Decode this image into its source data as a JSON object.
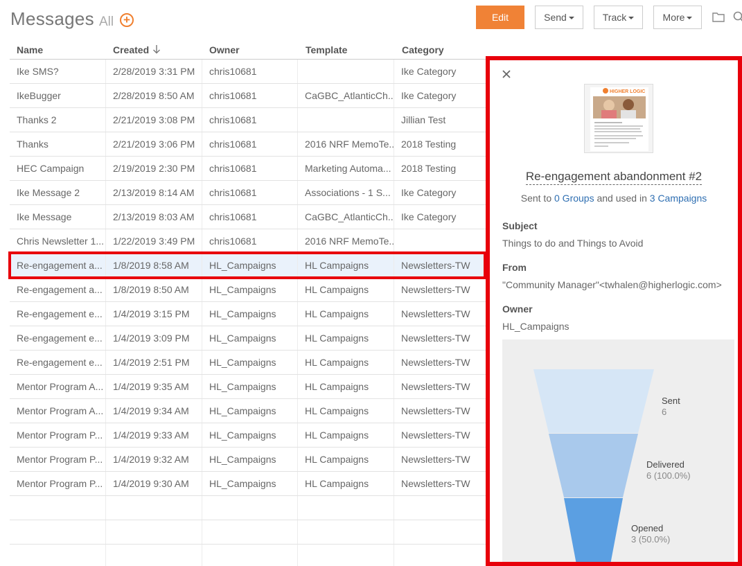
{
  "header": {
    "title": "Messages",
    "subtitle": "All",
    "add_label": "+"
  },
  "toolbar": {
    "edit_label": "Edit",
    "send_label": "Send",
    "track_label": "Track",
    "more_label": "More",
    "folder_icon": "folder-icon",
    "search_icon": "search-icon"
  },
  "table": {
    "columns": [
      "Name",
      "Created",
      "Owner",
      "Template",
      "Category"
    ],
    "sort_icon": "arrow-down-icon",
    "rows": [
      {
        "name": "Ike SMS?",
        "created": "2/28/2019 3:31 PM",
        "owner": "chris10681",
        "template": "",
        "category": "Ike Category"
      },
      {
        "name": "IkeBugger",
        "created": "2/28/2019 8:50 AM",
        "owner": "chris10681",
        "template": "CaGBC_AtlanticCh...",
        "category": "Ike Category"
      },
      {
        "name": "Thanks 2",
        "created": "2/21/2019 3:08 PM",
        "owner": "chris10681",
        "template": "",
        "category": "Jillian Test"
      },
      {
        "name": "Thanks",
        "created": "2/21/2019 3:06 PM",
        "owner": "chris10681",
        "template": "2016 NRF MemoTe...",
        "category": "2018 Testing"
      },
      {
        "name": "HEC Campaign",
        "created": "2/19/2019 2:30 PM",
        "owner": "chris10681",
        "template": "Marketing Automa...",
        "category": "2018 Testing"
      },
      {
        "name": "Ike Message 2",
        "created": "2/13/2019 8:14 AM",
        "owner": "chris10681",
        "template": "Associations - 1 S...",
        "category": "Ike Category"
      },
      {
        "name": "Ike Message",
        "created": "2/13/2019 8:03 AM",
        "owner": "chris10681",
        "template": "CaGBC_AtlanticCh...",
        "category": "Ike Category"
      },
      {
        "name": "Chris Newsletter 1...",
        "created": "1/22/2019 3:49 PM",
        "owner": "chris10681",
        "template": "2016 NRF MemoTe...",
        "category": ""
      },
      {
        "name": "Re-engagement a...",
        "created": "1/8/2019 8:58 AM",
        "owner": "HL_Campaigns",
        "template": "HL Campaigns",
        "category": "Newsletters-TW"
      },
      {
        "name": "Re-engagement a...",
        "created": "1/8/2019 8:50 AM",
        "owner": "HL_Campaigns",
        "template": "HL Campaigns",
        "category": "Newsletters-TW"
      },
      {
        "name": "Re-engagement e...",
        "created": "1/4/2019 3:15 PM",
        "owner": "HL_Campaigns",
        "template": "HL Campaigns",
        "category": "Newsletters-TW"
      },
      {
        "name": "Re-engagement e...",
        "created": "1/4/2019 3:09 PM",
        "owner": "HL_Campaigns",
        "template": "HL Campaigns",
        "category": "Newsletters-TW"
      },
      {
        "name": "Re-engagement e...",
        "created": "1/4/2019 2:51 PM",
        "owner": "HL_Campaigns",
        "template": "HL Campaigns",
        "category": "Newsletters-TW"
      },
      {
        "name": "Mentor Program A...",
        "created": "1/4/2019 9:35 AM",
        "owner": "HL_Campaigns",
        "template": "HL Campaigns",
        "category": "Newsletters-TW"
      },
      {
        "name": "Mentor Program A...",
        "created": "1/4/2019 9:34 AM",
        "owner": "HL_Campaigns",
        "template": "HL Campaigns",
        "category": "Newsletters-TW"
      },
      {
        "name": "Mentor Program P...",
        "created": "1/4/2019 9:33 AM",
        "owner": "HL_Campaigns",
        "template": "HL Campaigns",
        "category": "Newsletters-TW"
      },
      {
        "name": "Mentor Program P...",
        "created": "1/4/2019 9:32 AM",
        "owner": "HL_Campaigns",
        "template": "HL Campaigns",
        "category": "Newsletters-TW"
      },
      {
        "name": "Mentor Program P...",
        "created": "1/4/2019 9:30 AM",
        "owner": "HL_Campaigns",
        "template": "HL Campaigns",
        "category": "Newsletters-TW"
      }
    ],
    "selected_index": 8
  },
  "detail": {
    "close_icon": "close-icon",
    "thumbnail_brand": "HIGHER LOGIC",
    "title": "Re-engagement abandonment #2",
    "sent_prefix": "Sent to ",
    "groups_link": "0 Groups",
    "sent_middle": " and used in ",
    "campaigns_link": "3 Campaigns",
    "subject_label": "Subject",
    "subject_value": "Things to do and Things to Avoid",
    "from_label": "From",
    "from_value": "\"Community Manager\"<twhalen@higherlogic.com>",
    "owner_label": "Owner",
    "owner_value": "HL_Campaigns",
    "funnel": {
      "stages": [
        {
          "label": "Sent",
          "value": "6",
          "color": "#d6e6f6"
        },
        {
          "label": "Delivered",
          "value": "6 (100.0%)",
          "color": "#a9c9ec"
        },
        {
          "label": "Opened",
          "value": "3 (50.0%)",
          "color": "#5b9fe2"
        }
      ]
    }
  },
  "colors": {
    "accent": "#f08236",
    "highlight": "#e8000b",
    "link": "#2f6fb2"
  }
}
